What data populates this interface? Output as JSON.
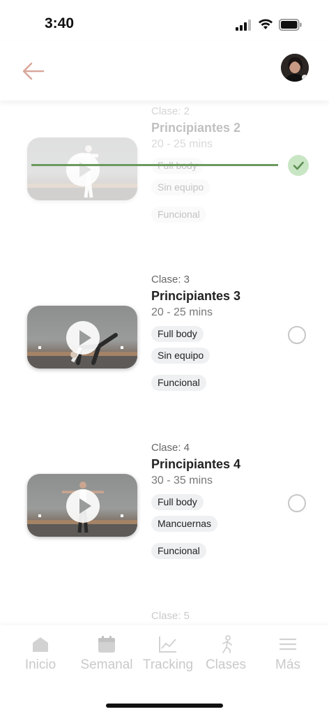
{
  "status_bar": {
    "time": "3:40"
  },
  "header": {
    "back_icon": "arrow-left-icon",
    "avatar": "user-avatar"
  },
  "classes": [
    {
      "clase": "Clase: 2",
      "title": "Principiantes 2",
      "duration": "20 - 25 mins",
      "tags": [
        "Full body",
        "Sin equipo",
        "Funcional"
      ],
      "completed": true
    },
    {
      "clase": "Clase: 3",
      "title": "Principiantes 3",
      "duration": "20 - 25 mins",
      "tags": [
        "Full body",
        "Sin equipo",
        "Funcional"
      ],
      "completed": false
    },
    {
      "clase": "Clase: 4",
      "title": "Principiantes 4",
      "duration": "30 - 35 mins",
      "tags": [
        "Full body",
        "Mancuernas",
        "Funcional"
      ],
      "completed": false
    },
    {
      "clase": "Clase: 5"
    }
  ],
  "nav": {
    "items": [
      {
        "label": "Inicio",
        "icon": "home-icon"
      },
      {
        "label": "Semanal",
        "icon": "calendar-icon"
      },
      {
        "label": "Tracking",
        "icon": "chart-icon"
      },
      {
        "label": "Clases",
        "icon": "running-person-icon"
      },
      {
        "label": "Más",
        "icon": "menu-icon"
      }
    ]
  },
  "colors": {
    "accent": "#d9a79a",
    "check_bg": "#c9e6c4",
    "check": "#5e8f55",
    "nav_inactive": "#c9c9c9"
  }
}
